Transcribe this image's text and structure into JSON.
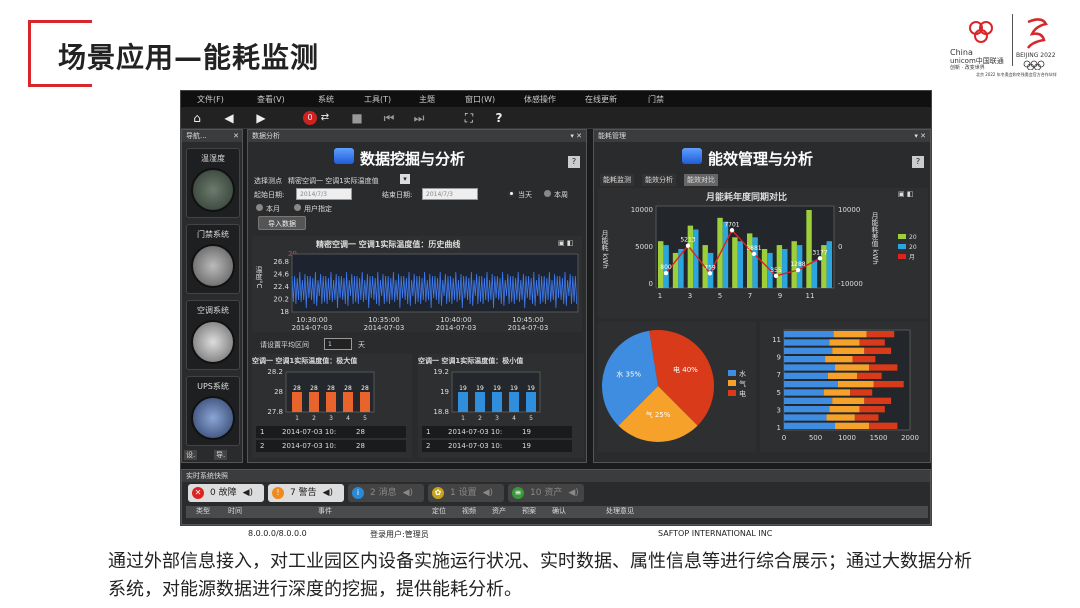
{
  "slide": {
    "title": "场景应用—能耗监测",
    "description": "通过外部信息接入，对工业园区内设备实施运行状况、实时数据、属性信息等进行综合展示；通过大数据分析系统，对能源数据进行深度的挖掘，提供能耗分析。",
    "logo_line1": "China",
    "logo_line2": "unicom中国联通",
    "logo_line3": "创新 · 改变世界",
    "logo_beijing": "BEIJING 2022",
    "logo_sub": "北京 2022 年冬奥会和冬残奥会官方合作伙伴"
  },
  "menu": [
    "文件(F)",
    "查看(V)",
    "系统",
    "工具(T)",
    "主题",
    "窗口(W)",
    "体感操作",
    "在线更新",
    "门禁"
  ],
  "toolbar": {
    "alarm_count": "0"
  },
  "nav": {
    "title": "导航...",
    "items": [
      "温湿度",
      "门禁系统",
      "空调系统",
      "UPS系统"
    ],
    "bottom_tabs": [
      "设.",
      "导."
    ]
  },
  "data_panel": {
    "tab": "数据分析",
    "heading": "数据挖掘与分析",
    "select_label": "选择测点",
    "select_value": "精密空调一 空调1实际温度值",
    "start_label": "起始日期:",
    "start_value": "2014/7/3",
    "end_label": "结束日期:",
    "end_value": "2014/7/3",
    "radio_today": "当天",
    "radio_week": "本周",
    "radio_month": "本月",
    "radio_custom": "用户指定",
    "import_button": "导入数据",
    "chart_title": "精密空调一 空调1实际温度值：历史曲线",
    "y_axis": "温度°C",
    "y_ticks": [
      "26.8",
      "24.6",
      "22.4",
      "20.2",
      "18"
    ],
    "top_tick": "29",
    "x_ticks": [
      [
        "10:30:00",
        "2014-07-03"
      ],
      [
        "10:35:00",
        "2014-07-03"
      ],
      [
        "10:40:00",
        "2014-07-03"
      ],
      [
        "10:45:00",
        "2014-07-03"
      ]
    ],
    "interval_label": "请设置平均区间",
    "interval_value": "1",
    "interval_unit": "天",
    "max_title": "空调一 空调1实际温度值：极大值",
    "min_title": "空调一 空调1实际温度值：极小值",
    "max_ticks": [
      "28.2",
      "28",
      "27.8"
    ],
    "min_ticks": [
      "19.2",
      "19",
      "18.8"
    ],
    "max_values": [
      "28",
      "28",
      "28",
      "28",
      "28"
    ],
    "min_values": [
      "19",
      "19",
      "19",
      "19",
      "19"
    ],
    "bar_x": [
      "1",
      "2",
      "3",
      "4",
      "5"
    ],
    "max_rows": [
      [
        "1",
        "2014-07-03 10:",
        "28"
      ],
      [
        "2",
        "2014-07-03 10:",
        "28"
      ]
    ],
    "min_rows": [
      [
        "1",
        "2014-07-03 10:",
        "19"
      ],
      [
        "2",
        "2014-07-03 10:",
        "19"
      ]
    ]
  },
  "energy_panel": {
    "tab": "能耗管理",
    "heading": "能效管理与分析",
    "tabs": [
      "能耗监测",
      "能效分析",
      "能效对比"
    ],
    "chart_title": "月能耗年度同期对比",
    "y_left": "月能耗 kWh",
    "y_right": "月能耗差值 kWh",
    "y_left_ticks": [
      "10000",
      "5000",
      "0"
    ],
    "y_right_ticks": [
      "10000",
      "0",
      "-10000"
    ],
    "x_ticks": [
      "1",
      "3",
      "5",
      "7",
      "9",
      "11"
    ],
    "point_labels": [
      "800",
      "5213",
      "759",
      "7701",
      "3881",
      "355",
      "1288",
      "3177"
    ],
    "legend": [
      "20",
      "20",
      "月"
    ],
    "pie_labels": [
      "电 40%",
      "气 25%",
      "水 35%"
    ],
    "pie_legend": [
      "水",
      "气",
      "电"
    ],
    "hbar_y": [
      "11",
      "9",
      "7",
      "5",
      "3",
      "1"
    ],
    "hbar_x": [
      "0",
      "500",
      "1000",
      "1500",
      "2000"
    ]
  },
  "status": {
    "title": "实时系统快照",
    "buttons": [
      "0 故障",
      "7 警告",
      "2 消息",
      "1 设置",
      "10 资产"
    ],
    "columns": [
      "类型",
      "时间",
      "事件",
      "定位",
      "视频",
      "资产",
      "预案",
      "确认",
      "处理意见"
    ]
  },
  "footer": {
    "version": "8.0.0.0/8.0.0.0",
    "user": "登录用户:管理员",
    "company": "SAFTOP INTERNATIONAL INC"
  },
  "chart_data": [
    {
      "type": "line",
      "title": "精密空调一 空调1实际温度值：历史曲线",
      "ylabel": "温度°C",
      "ylim": [
        18,
        29
      ],
      "x": [
        "10:30:00",
        "10:35:00",
        "10:40:00",
        "10:45:00"
      ],
      "series": [
        {
          "name": "实际温度值",
          "values": [
            26,
            20,
            27,
            19,
            26,
            21,
            27,
            20
          ]
        }
      ]
    },
    {
      "type": "bar",
      "title": "空调一 空调1实际温度值：极大值",
      "categories": [
        "1",
        "2",
        "3",
        "4",
        "5"
      ],
      "values": [
        28,
        28,
        28,
        28,
        28
      ],
      "ylim": [
        27.8,
        28.2
      ]
    },
    {
      "type": "bar",
      "title": "空调一 空调1实际温度值：极小值",
      "categories": [
        "1",
        "2",
        "3",
        "4",
        "5"
      ],
      "values": [
        19,
        19,
        19,
        19,
        19
      ],
      "ylim": [
        18.8,
        19.2
      ]
    },
    {
      "type": "bar",
      "title": "月能耗年度同期对比",
      "categories": [
        "1",
        "2",
        "3",
        "4",
        "5",
        "6",
        "7",
        "8",
        "9",
        "10",
        "11",
        "12"
      ],
      "series": [
        {
          "values": [
            6000,
            4500,
            8000,
            5500,
            9000,
            6500,
            7000,
            5000,
            5500,
            6000,
            10000,
            5500
          ]
        },
        {
          "values": [
            5500,
            5000,
            7500,
            4500,
            8500,
            6000,
            6500,
            4500,
            5000,
            5500,
            3500,
            6000
          ]
        }
      ],
      "line": [
        800,
        5213,
        759,
        7701,
        3881,
        355,
        1288,
        3177
      ],
      "ylim": [
        0,
        10000
      ]
    },
    {
      "type": "pie",
      "categories": [
        "电",
        "气",
        "水"
      ],
      "values": [
        40,
        25,
        35
      ]
    },
    {
      "type": "bar",
      "categories": [
        "1",
        "2",
        "3",
        "4",
        "5",
        "6",
        "7",
        "8",
        "9",
        "10",
        "11",
        "12"
      ],
      "values": [
        1800,
        1500,
        1600,
        1700,
        1400,
        1900,
        1550,
        1800,
        1450,
        1700,
        1600,
        1750
      ],
      "ylim": [
        0,
        2000
      ]
    }
  ]
}
